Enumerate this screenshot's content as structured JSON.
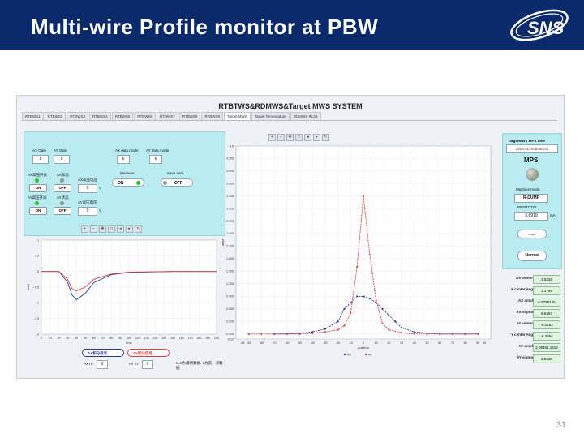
{
  "slide": {
    "title": "Multi-wire Profile monitor at PBW",
    "logo_text": "SNS",
    "page_number": "31",
    "colors": {
      "header_bg": "#0b2a6b",
      "panel": "#b9ecf0",
      "ax_series": "#2a3a9b",
      "ay_series": "#d94040"
    }
  },
  "app": {
    "title": "RTBTWS&RDMWS&Target MWS SYSTEM",
    "tabs": [
      "RTBWS1",
      "RTBWS2",
      "RTBWS3",
      "RTBWS4",
      "RTBWS5",
      "RTBWS6",
      "RTBWS7",
      "RTBWS8",
      "RTBWS9",
      "Target MWS",
      "Target Temperature",
      "RDMWS-RL08"
    ],
    "active_tab": "Target MWS",
    "controls": {
      "ax_gain_label": "AX Gain",
      "ax_gain_value": "5",
      "ay_gain_label": "AY Gain",
      "ay_gain_value": "5",
      "ax_mode_label": "AX data mode",
      "ax_mode_value": "k",
      "ay_mode_label": "AY data mode",
      "ay_mode_value": "k",
      "measure_label": "Measure",
      "measure_value": "ON",
      "save_label": "Save data",
      "save_value": "OFF",
      "ax_stage1_label": "AX高压开关",
      "ax_stage1_value": "ON",
      "ax_stage2_label": "AX状态",
      "ax_stage2_value": "OFF",
      "ax_volt_label": "AX高压电压",
      "ax_volt_value": "0",
      "ax_volt_unit": "V",
      "ay_stage1_label": "AY高压开关",
      "ay_stage1_value": "ON",
      "ay_stage2_label": "AY状态",
      "ay_stage2_value": "OFF",
      "ay_volt_label": "AY高压电压",
      "ay_volt_value": "0",
      "ay_volt_unit": "V"
    },
    "mps": {
      "time_label": "TargetMWS MPS time",
      "time_value": "2018/7/13 9:38:05.278",
      "title": "MPS",
      "machine_mode_label": "Machine mode",
      "machine_mode_value": "R-DUMP",
      "current_label": "IBEBTCT01",
      "current_value": "5.6919",
      "current_unit": "mA",
      "reset_label": "reset",
      "normal_label": "Normal"
    },
    "readouts": [
      {
        "label": "AX center",
        "value": "2.5226"
      },
      {
        "label": "X center Avg",
        "value": "3.1799"
      },
      {
        "label": "AX ampl",
        "value": "6.9758125"
      },
      {
        "label": "AX sigma",
        "value": "6.6467"
      },
      {
        "label": "AY center",
        "value": "-6.0253"
      },
      {
        "label": "Y center Avg",
        "value": "-6.3694"
      },
      {
        "label": "AY ampl",
        "value": "2.09461.1912"
      },
      {
        "label": "AY sigma",
        "value": "2.5436"
      }
    ],
    "bottom": {
      "ax_sum_btn": "AX积分信号",
      "ay_sum_btn": "AY积分信号",
      "ax_n_label": "AX n=",
      "ax_n_value": "0",
      "ay_n_label": "AY n=",
      "ay_n_value": "0",
      "note": "n=0为最新数据, 1为前一次数据"
    }
  },
  "chart_data": [
    {
      "type": "line",
      "ylabel": "ampl",
      "xlabel": "time",
      "xlim": [
        0,
        200
      ],
      "ylim": [
        -2,
        1
      ],
      "x_ticks": [
        "0",
        "10",
        "20",
        "30",
        "40",
        "50",
        "60",
        "70",
        "80",
        "90",
        "100",
        "110",
        "120",
        "130",
        "140",
        "150",
        "160",
        "170",
        "180",
        "190",
        "200"
      ],
      "y_ticks": [
        "1",
        "0.5",
        "0",
        "-0.5",
        "-1",
        "-1.5",
        "-2"
      ],
      "series": [
        {
          "name": "AX积分信号",
          "x": [
            0,
            20,
            30,
            35,
            40,
            50,
            60,
            80,
            100,
            150,
            200
          ],
          "values": [
            0,
            0,
            -0.35,
            -0.75,
            -0.9,
            -0.7,
            -0.35,
            -0.1,
            -0.03,
            0,
            0
          ]
        },
        {
          "name": "AY积分信号",
          "x": [
            0,
            20,
            30,
            35,
            40,
            50,
            60,
            80,
            100,
            150,
            200
          ],
          "values": [
            0,
            0,
            -0.25,
            -0.55,
            -0.62,
            -0.5,
            -0.25,
            -0.08,
            -0.02,
            0,
            0
          ]
        }
      ]
    },
    {
      "type": "line",
      "ylabel": "ampl",
      "xlabel": "position",
      "xlim": [
        -100,
        100
      ],
      "ylim": [
        -0.12,
        4.5
      ],
      "x_ticks": [
        "-95",
        "-90",
        "-80",
        "-70",
        "-60",
        "-50",
        "-40",
        "-30",
        "-20",
        "-10",
        "0",
        "10",
        "20",
        "30",
        "40",
        "50",
        "60",
        "70",
        "80",
        "90",
        "95"
      ],
      "y_ticks": [
        "4.5",
        "4.205",
        "3.905",
        "3.605",
        "3.305",
        "3.005",
        "2.705",
        "2.405",
        "2.105",
        "1.805",
        "1.505",
        "1.205",
        "0.905",
        "0.605",
        "0.305",
        "0.005",
        "-0.12"
      ],
      "series": [
        {
          "name": "AX",
          "x": [
            -70,
            -60,
            -50,
            -40,
            -30,
            -20,
            -15,
            -10,
            -5,
            0,
            5,
            10,
            15,
            20,
            25,
            30,
            40,
            50,
            60,
            70,
            80,
            90
          ],
          "values": [
            0,
            0,
            0.02,
            0.05,
            0.12,
            0.3,
            0.6,
            0.75,
            0.9,
            0.9,
            0.85,
            0.75,
            0.6,
            0.45,
            0.3,
            0.15,
            0.05,
            0.02,
            0,
            0,
            0,
            0
          ]
        },
        {
          "name": "AY",
          "x": [
            -90,
            -80,
            -70,
            -60,
            -50,
            -40,
            -30,
            -20,
            -15,
            -10,
            -5,
            0,
            5,
            10,
            15,
            20,
            30,
            40,
            50,
            60,
            70,
            80,
            90
          ],
          "values": [
            0,
            0,
            0,
            0,
            0,
            0.02,
            0.05,
            0.1,
            0.2,
            0.5,
            1.6,
            3.3,
            1.9,
            0.8,
            0.25,
            0.1,
            0.03,
            0,
            0,
            0,
            0,
            0,
            0
          ]
        }
      ]
    }
  ]
}
